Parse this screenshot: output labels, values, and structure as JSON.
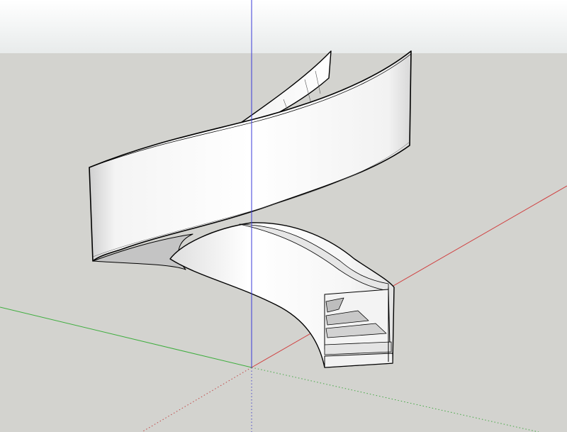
{
  "scene": {
    "model": "spiral-staircase",
    "colors": {
      "sky": "#ffffff",
      "sky_bottom": "#e9ecec",
      "ground": "#d3d3cf",
      "red_axis": "#d04040",
      "green_axis": "#3fae3f",
      "blue_axis": "#3a3ad8",
      "surface": "#ffffff",
      "shade": "#c9c9c9",
      "edge": "#000000"
    },
    "icons": [
      "red-axis-icon",
      "green-axis-icon",
      "blue-axis-icon",
      "spiral-staircase-icon"
    ]
  }
}
